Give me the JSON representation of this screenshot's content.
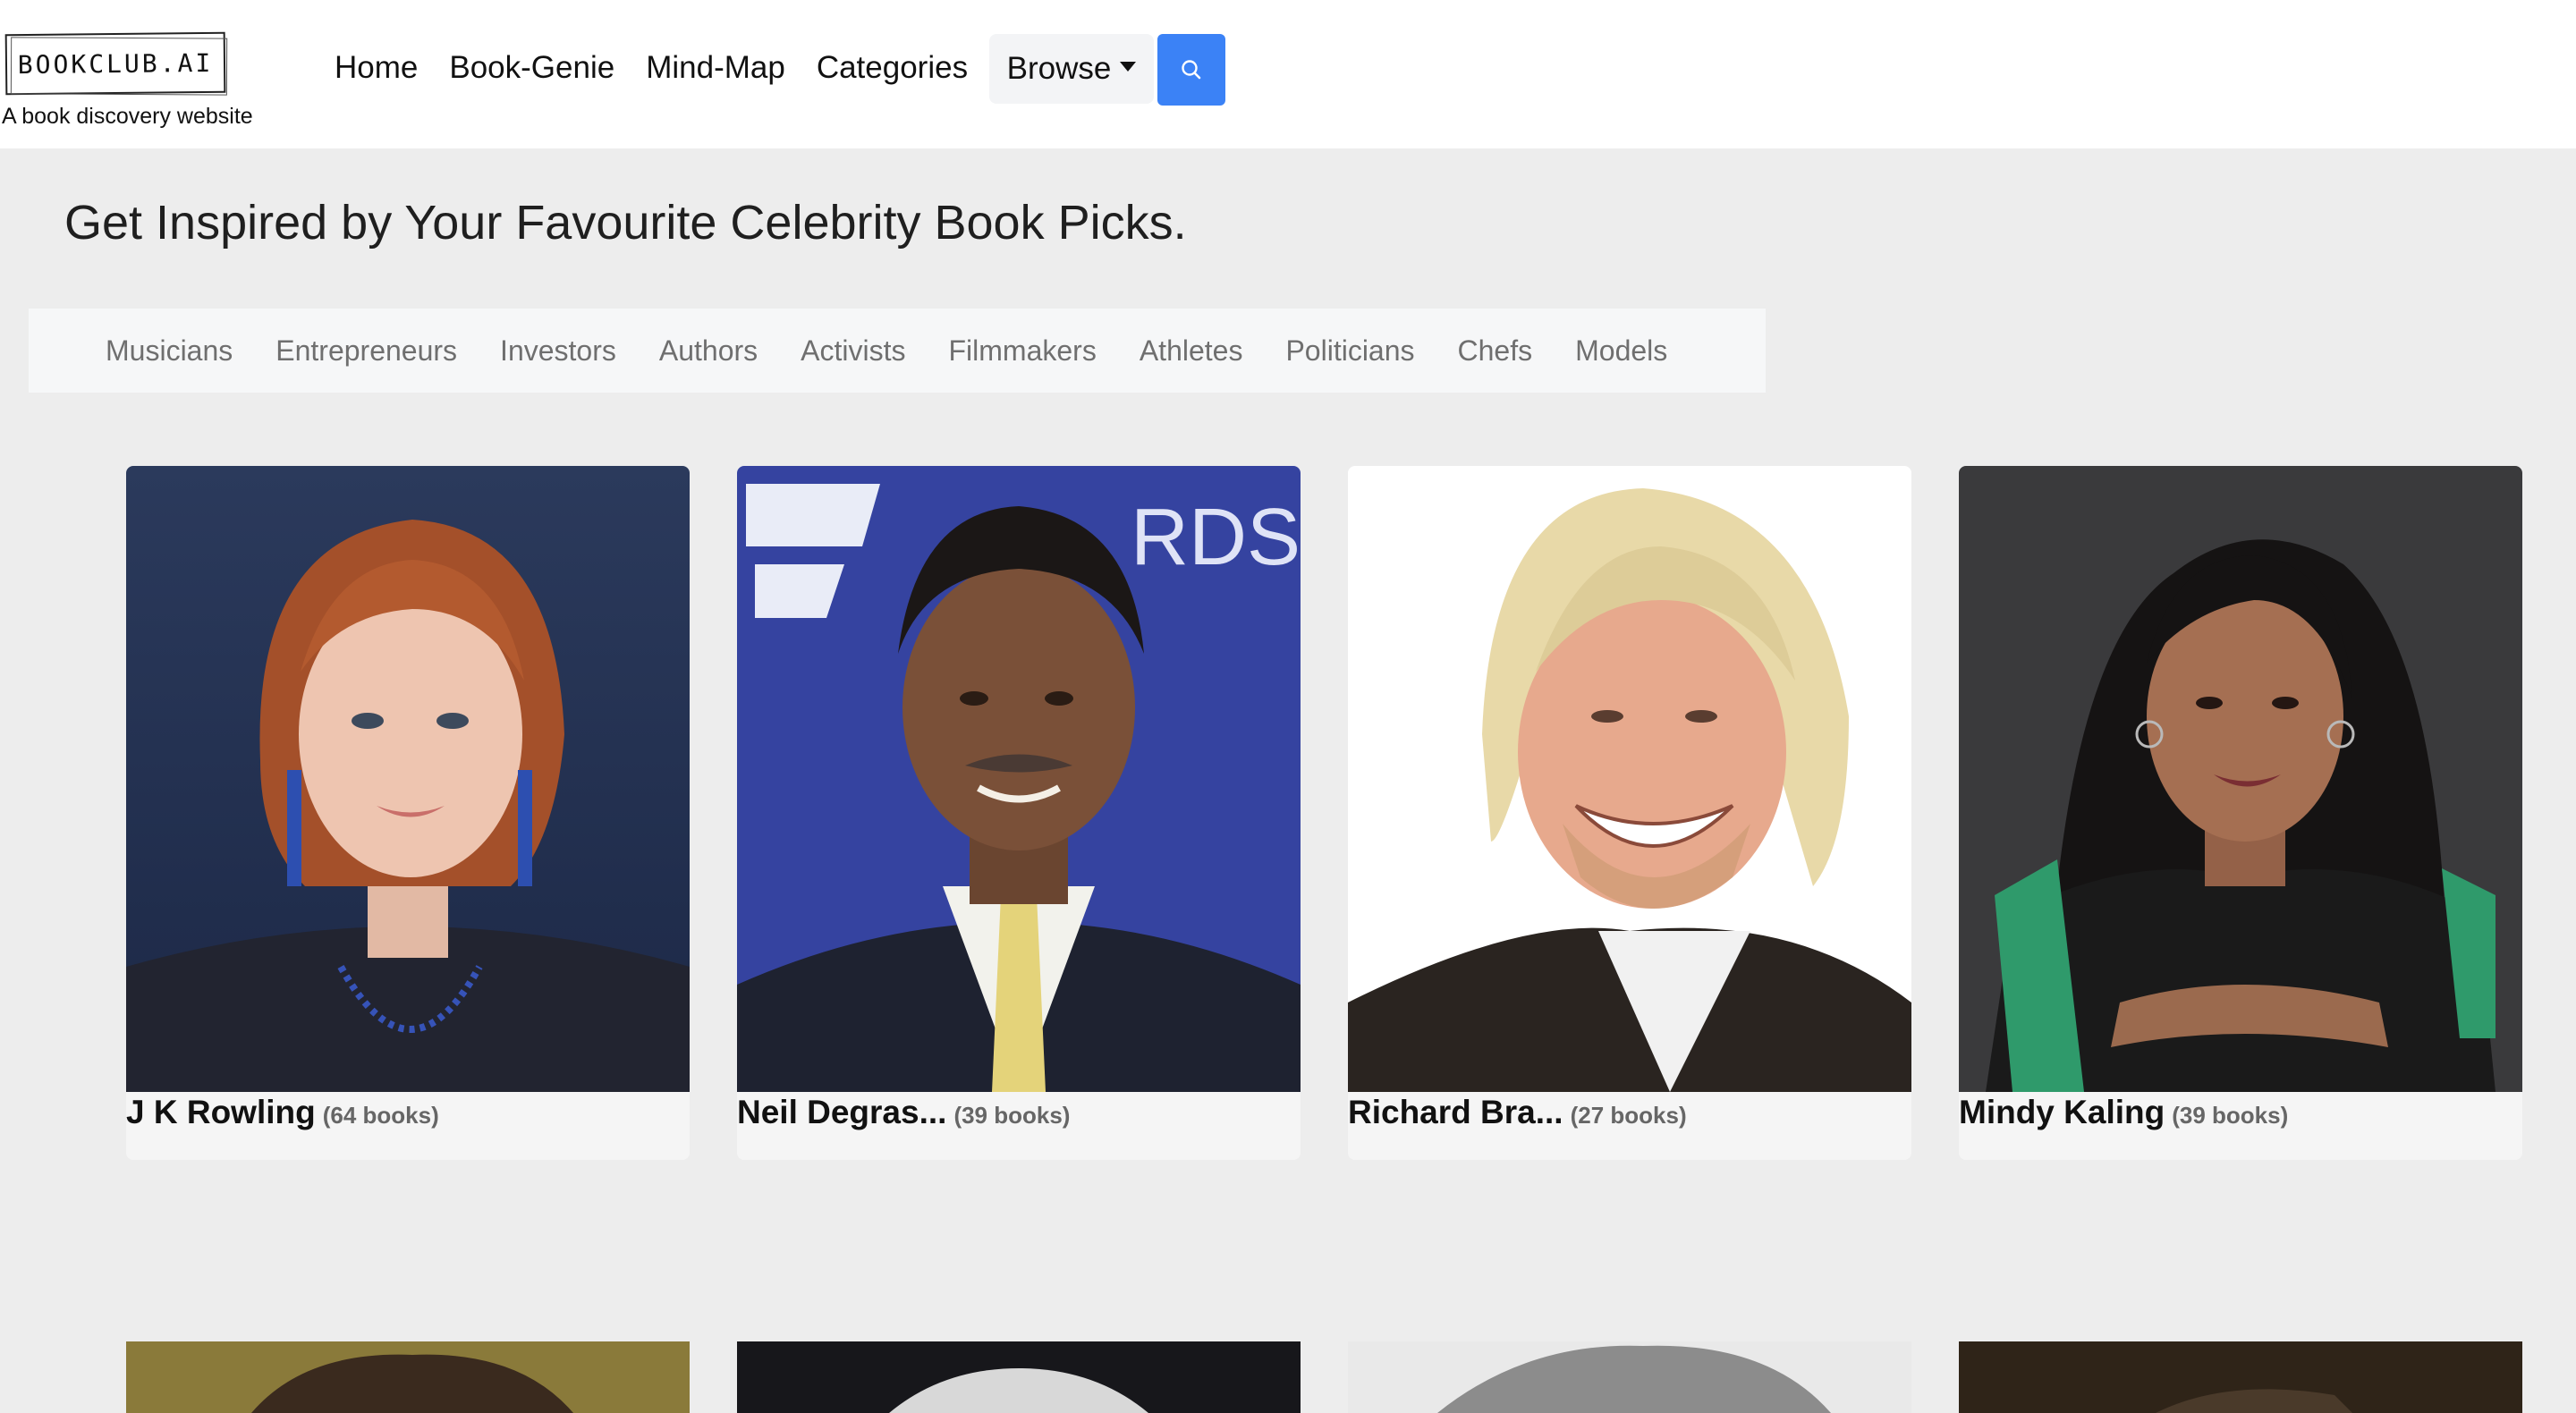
{
  "header": {
    "logo": "BOOKCLUB.AI",
    "tagline": "A book discovery website",
    "nav": [
      "Home",
      "Book-Genie",
      "Mind-Map",
      "Categories"
    ],
    "browse_label": "Browse",
    "search_icon": "search-icon"
  },
  "main": {
    "title": "Get Inspired by Your Favourite Celebrity Book Picks.",
    "tabs": [
      "Musicians",
      "Entrepreneurs",
      "Investors",
      "Authors",
      "Activists",
      "Filmmakers",
      "Athletes",
      "Politicians",
      "Chefs",
      "Models"
    ],
    "cards": [
      {
        "name": "J K Rowling",
        "count": "(64 books)"
      },
      {
        "name": "Neil Degras...",
        "count": "(39 books)"
      },
      {
        "name": "Richard Bra...",
        "count": "(27 books)"
      },
      {
        "name": "Mindy Kaling",
        "count": "(39 books)"
      }
    ]
  },
  "colors": {
    "accent": "#3b82f6",
    "page_bg": "#ededed"
  }
}
